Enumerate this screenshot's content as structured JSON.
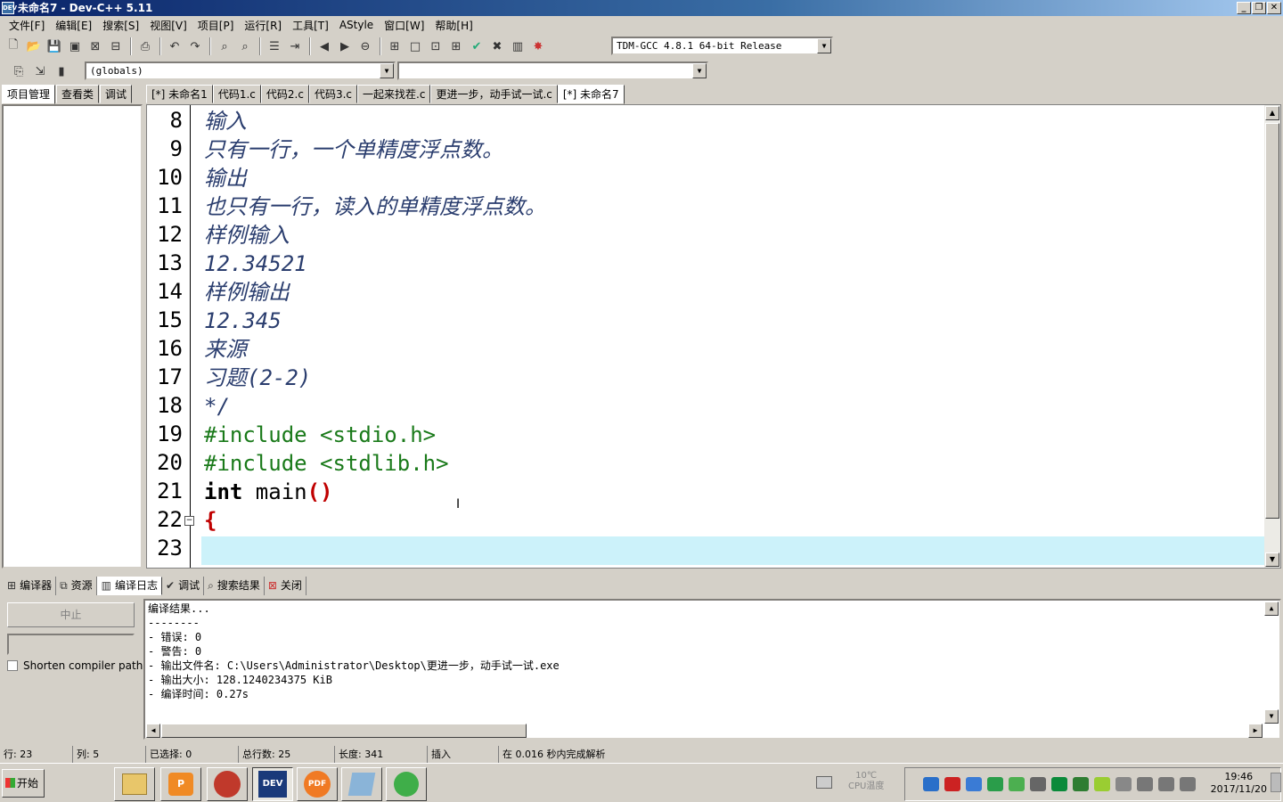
{
  "window": {
    "title": "未命名7 - Dev-C++ 5.11",
    "app_icon": "DEV"
  },
  "menu": [
    "文件[F]",
    "编辑[E]",
    "搜索[S]",
    "视图[V]",
    "项目[P]",
    "运行[R]",
    "工具[T]",
    "AStyle",
    "窗口[W]",
    "帮助[H]"
  ],
  "compiler_select": "TDM-GCC 4.8.1 64-bit Release",
  "scope_select": "(globals)",
  "left_tabs": [
    "项目管理",
    "查看类",
    "调试"
  ],
  "editor_tabs": [
    "[*] 未命名1",
    "代码1.c",
    "代码2.c",
    "代码3.c",
    "一起来找茬.c",
    "更进一步，动手试一试.c",
    "[*] 未命名7"
  ],
  "code": {
    "line_numbers": [
      "8",
      "9",
      "10",
      "11",
      "12",
      "13",
      "14",
      "15",
      "16",
      "17",
      "18",
      "19",
      "20",
      "21",
      "22",
      "23"
    ],
    "l8": "输入",
    "l9": "只有一行，一个单精度浮点数。",
    "l10": "输出",
    "l11": "也只有一行，读入的单精度浮点数。",
    "l12": "样例输入",
    "l13": "12.34521",
    "l14": "样例输出",
    "l15": "12.345",
    "l16": "来源",
    "l17": "习题(2-2)",
    "l18": "*/",
    "l19": "#include <stdio.h>",
    "l20": "#include <stdlib.h>",
    "l21_kw": "int",
    "l21_rest": " main",
    "l21_paren": "()",
    "l22": "{"
  },
  "bottom_tabs": [
    "编译器",
    "资源",
    "编译日志",
    "调试",
    "搜索结果",
    "关闭"
  ],
  "stop_button": "中止",
  "shorten_label": "Shorten compiler paths",
  "output_lines": [
    "编译结果...",
    "--------",
    "- 错误: 0",
    "- 警告: 0",
    "- 输出文件名: C:\\Users\\Administrator\\Desktop\\更进一步，动手试一试.exe",
    "- 输出大小: 128.1240234375 KiB",
    "- 编译时间: 0.27s"
  ],
  "status": {
    "row_label": "行:",
    "row": "23",
    "col_label": "列:",
    "col": "5",
    "sel_label": "已选择:",
    "sel": "0",
    "total_label": "总行数:",
    "total": "25",
    "len_label": "长度:",
    "len": "341",
    "mode": "插入",
    "parse": "在 0.016 秒内完成解析"
  },
  "taskbar": {
    "start": "开始",
    "temp": "10℃",
    "cpu_label": "CPU温度",
    "time": "19:46",
    "date": "2017/11/20",
    "dev_label": "DEV"
  }
}
